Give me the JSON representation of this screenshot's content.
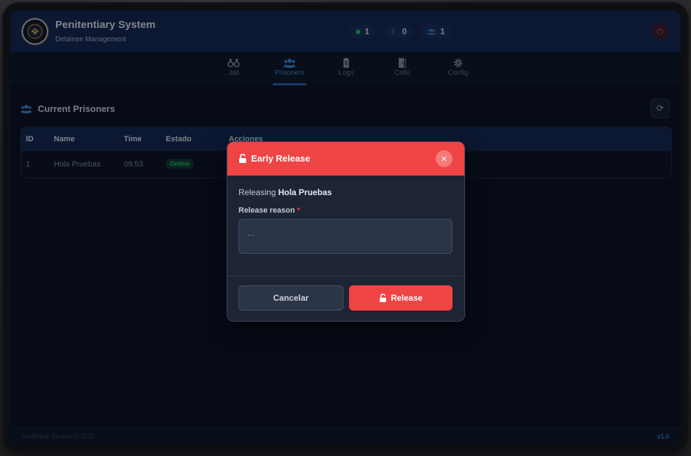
{
  "header": {
    "title": "Penitentiary System",
    "subtitle": "Detainee Management",
    "stats": [
      {
        "icon": "online-dot-icon",
        "value": "1"
      },
      {
        "icon": "moon-icon",
        "value": "0"
      },
      {
        "icon": "users-icon",
        "value": "1"
      }
    ]
  },
  "nav": {
    "tabs": [
      {
        "label": "Jail",
        "icon": "binoculars-icon"
      },
      {
        "label": "Prisoners",
        "icon": "users-icon",
        "active": true
      },
      {
        "label": "Logs",
        "icon": "clipboard-icon"
      },
      {
        "label": "Cells",
        "icon": "door-icon"
      },
      {
        "label": "Config",
        "icon": "gear-icon"
      }
    ]
  },
  "main": {
    "section_title": "Current Prisoners",
    "table": {
      "columns": [
        "ID",
        "Name",
        "Time",
        "Estado",
        "Acciones"
      ],
      "rows": [
        {
          "id": "1",
          "name": "Hola Pruebas",
          "time": "09:53",
          "status": "Online"
        }
      ]
    }
  },
  "footer": {
    "copyright": "VoidPatch Studios © 2025",
    "version": "v1.0"
  },
  "modal": {
    "title": "Early Release",
    "releasing_prefix": "Releasing",
    "releasing_name": "Hola Pruebas",
    "reason_label": "Release reason",
    "required_mark": "*",
    "reason_placeholder": "...",
    "cancel_label": "Cancelar",
    "release_label": "Release"
  },
  "colors": {
    "header_bg": "#14254f",
    "accent_blue": "#1e6fc2",
    "danger_red": "#ef4444",
    "online_green": "#22c55e"
  }
}
